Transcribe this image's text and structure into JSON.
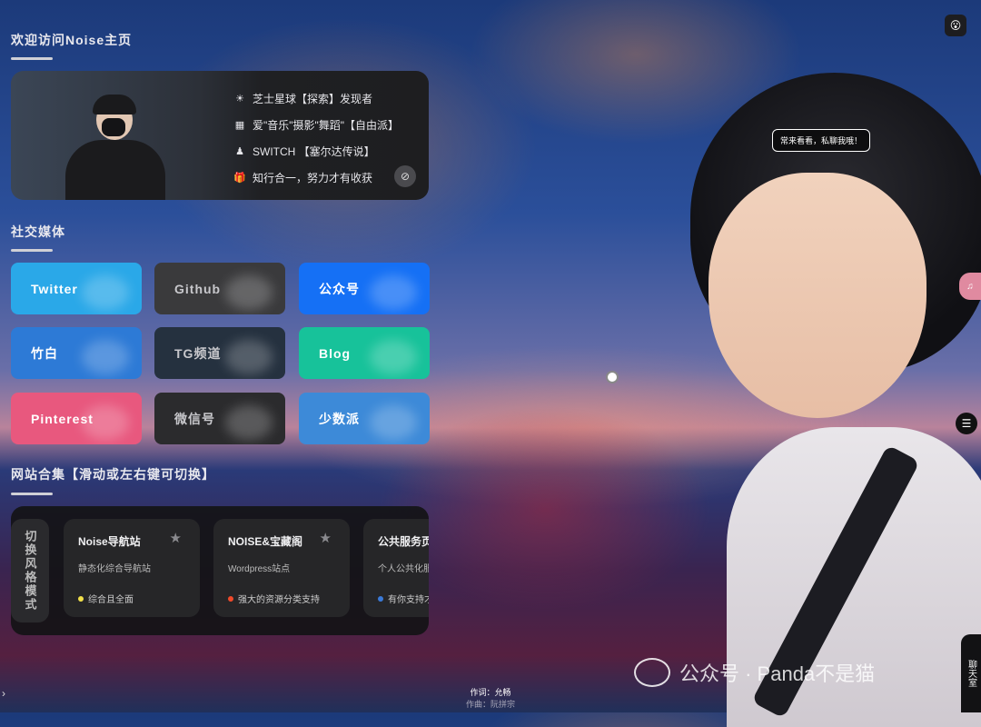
{
  "header": {
    "welcome_title": "欢迎访问Noise主页"
  },
  "profile": {
    "lines": [
      {
        "icon": "sun-icon",
        "glyph": "☀",
        "text": "芝士星球【探索】发现者"
      },
      {
        "icon": "film-icon",
        "glyph": "▦",
        "text": "爱\"音乐\"摄影\"舞蹈\"【自由派】"
      },
      {
        "icon": "joystick-icon",
        "glyph": "♟",
        "text": "SWITCH 【塞尔达传说】"
      },
      {
        "icon": "gift-icon",
        "glyph": "🎁",
        "text": "知行合一，努力才有收获"
      }
    ]
  },
  "social": {
    "title": "社交媒体",
    "buttons": [
      {
        "label": "Twitter",
        "color": "#2aa8e8"
      },
      {
        "label": "Github",
        "color": "#3a3a3c"
      },
      {
        "label": "公众号",
        "color": "#1570f5"
      },
      {
        "label": "竹白",
        "color": "#2d7ad6"
      },
      {
        "label": "TG频道",
        "color": "#25313f"
      },
      {
        "label": "Blog",
        "color": "#17c29a"
      },
      {
        "label": "Pinterest",
        "color": "#e8587e"
      },
      {
        "label": "微信号",
        "color": "#2b2b2d"
      },
      {
        "label": "少数派",
        "color": "#3d8ad8"
      }
    ]
  },
  "sites": {
    "title": "网站合集【滑动或左右键可切换】",
    "switch_label": "切换风格模式",
    "cards": [
      {
        "title": "Noise导航站",
        "desc": "静态化综合导航站",
        "tag": "综合且全面",
        "tag_color": "#f2e04a"
      },
      {
        "title": "NOISE&宝藏阁",
        "desc": "Wordpress站点",
        "tag": "强大的资源分类支持",
        "tag_color": "#f04a2a"
      },
      {
        "title": "公共服务页",
        "desc": "个人公共化服",
        "tag": "有你支持才",
        "tag_color": "#3a7ad8"
      }
    ]
  },
  "bubble": {
    "text": "常来看看，私聊我哦！"
  },
  "side": {
    "chat_label": "聊天室",
    "pink_label": "♫"
  },
  "footer": {
    "lyric": "作词：允畅",
    "composer": "作曲：阮拼宗"
  },
  "watermark": {
    "text": "公众号 · Panda不是猫"
  }
}
